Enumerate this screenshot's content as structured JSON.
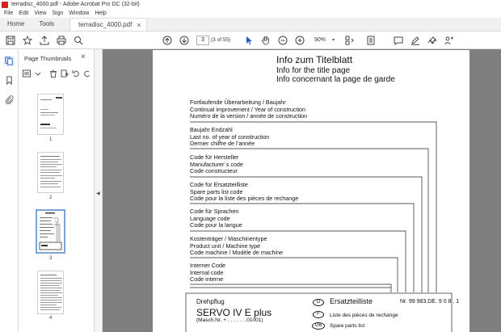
{
  "window": {
    "title": "terradisc_4000.pdf - Adobe Acrobat Pro DC (32-bit)"
  },
  "menu": [
    "File",
    "Edit",
    "View",
    "Sign",
    "Window",
    "Help"
  ],
  "tabs": {
    "home": "Home",
    "tools": "Tools",
    "doc": "terradisc_4000.pdf",
    "close": "×"
  },
  "toolbar": {
    "page_number": "3",
    "page_count": "(3 of 55)",
    "zoom": "90%"
  },
  "sidebar": {
    "title": "Page Thumbnails",
    "close": "×"
  },
  "thumbnails": [
    {
      "number": "1"
    },
    {
      "number": "2"
    },
    {
      "number": "3"
    },
    {
      "number": "4"
    }
  ],
  "page": {
    "title_de": "Info  zum  Titelblatt",
    "title_en": "Info for the title page",
    "title_fr": "Info concernant la page de garde",
    "groups": [
      {
        "lines": [
          "Fortlaufende Überarbeitung / Baujahr",
          "Continual improvement / Year of construction",
          "Numéro de la version / année de construction"
        ]
      },
      {
        "lines": [
          "Baujahr Endzahl",
          "Last no. of year of construction",
          "Dernier chiffre de l’année"
        ]
      },
      {
        "lines": [
          "Code für Hersteller",
          "Manufacturer´s  code",
          "Code constructeur"
        ]
      },
      {
        "lines": [
          "Code für Ersatzteilliste",
          "Spare parts list code",
          "Code pour la liste des pièces de rechange"
        ]
      },
      {
        "lines": [
          "Code für Sprachen",
          "Language code",
          "Code pour la langue"
        ]
      },
      {
        "lines": [
          "Kostenträger / Maschinentype",
          "Product unit / Machine type",
          "Code machine / Modèle de machine"
        ]
      },
      {
        "lines": [
          "Interner Code",
          "Internal code",
          "Code interne"
        ]
      }
    ],
    "box": {
      "label": "Drehpflug",
      "model": "SERVO IV E plus",
      "serial": "(Masch.Nr. + . . . . . . .01001)",
      "lang_d": "D",
      "lang_f": "F",
      "lang_gb": "GB",
      "ersatz": "Ersatzteilliste",
      "nr": "Nr. 99 983.DE. 9 0 8 . 1",
      "liste": "Liste des pièces de rechange",
      "spare": "Spare parts list"
    }
  }
}
